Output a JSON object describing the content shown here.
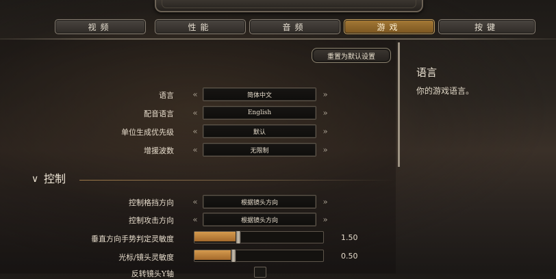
{
  "tabs": [
    {
      "label": "视频",
      "active": false
    },
    {
      "label": "性能",
      "active": false
    },
    {
      "label": "音频",
      "active": false
    },
    {
      "label": "游戏",
      "active": true
    },
    {
      "label": "按键",
      "active": false
    }
  ],
  "reset_button": "重置为默认设置",
  "description": {
    "title": "语言",
    "text": "你的游戏语言。"
  },
  "general_settings": [
    {
      "label": "语言",
      "value": "简体中文"
    },
    {
      "label": "配音语言",
      "value": "English"
    },
    {
      "label": "单位生成优先级",
      "value": "默认"
    },
    {
      "label": "增援波数",
      "value": "无限制"
    }
  ],
  "control_section": {
    "title": "控制",
    "selectors": [
      {
        "label": "控制格挡方向",
        "value": "根据镜头方向"
      },
      {
        "label": "控制攻击方向",
        "value": "根据镜头方向"
      }
    ],
    "sliders": [
      {
        "label": "垂直方向手势判定灵敏度",
        "value_text": "1.50",
        "fraction": 0.34
      },
      {
        "label": "光标/镜头灵敏度",
        "value_text": "0.50",
        "fraction": 0.3
      }
    ],
    "checkbox_row": {
      "label": "反转镜头Y轴",
      "checked": false
    }
  },
  "colors": {
    "accent": "#a57a36",
    "slider_fill": "#d59b4e",
    "background": "#2a2520"
  },
  "icons": {
    "selector_left": "double-chevron-left-icon",
    "selector_right": "double-chevron-right-icon",
    "section_toggle": "chevron-down-icon"
  }
}
